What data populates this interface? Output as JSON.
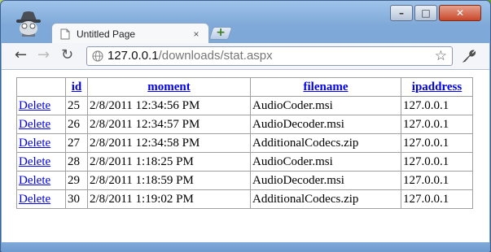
{
  "browser": {
    "tab_title": "Untitled Page",
    "tab_close": "×",
    "new_tab": "+",
    "url_host": "127.0.0.1",
    "url_path": "/downloads/stat.aspx",
    "window_buttons": {
      "minimize": "–",
      "maximize": "□",
      "close": "✕"
    },
    "nav": {
      "back": "←",
      "forward": "→",
      "reload": "↻"
    },
    "star": "☆"
  },
  "table": {
    "headers": [
      "",
      "id",
      "moment",
      "filename",
      "ipaddress"
    ],
    "rows": [
      {
        "action": "Delete",
        "id": "25",
        "moment": "2/8/2011 12:34:56 PM",
        "filename": "AudioCoder.msi",
        "ipaddress": "127.0.0.1"
      },
      {
        "action": "Delete",
        "id": "26",
        "moment": "2/8/2011 12:34:57 PM",
        "filename": "AudioDecoder.msi",
        "ipaddress": "127.0.0.1"
      },
      {
        "action": "Delete",
        "id": "27",
        "moment": "2/8/2011 12:34:58 PM",
        "filename": "AdditionalCodecs.zip",
        "ipaddress": "127.0.0.1"
      },
      {
        "action": "Delete",
        "id": "28",
        "moment": "2/8/2011 1:18:25 PM",
        "filename": "AudioCoder.msi",
        "ipaddress": "127.0.0.1"
      },
      {
        "action": "Delete",
        "id": "29",
        "moment": "2/8/2011 1:18:59 PM",
        "filename": "AudioDecoder.msi",
        "ipaddress": "127.0.0.1"
      },
      {
        "action": "Delete",
        "id": "30",
        "moment": "2/8/2011 1:19:02 PM",
        "filename": "AdditionalCodecs.zip",
        "ipaddress": "127.0.0.1"
      }
    ]
  },
  "colors": {
    "link": "#0000ee",
    "frame": "#7fa9d8",
    "border": "#a0a0a0"
  }
}
